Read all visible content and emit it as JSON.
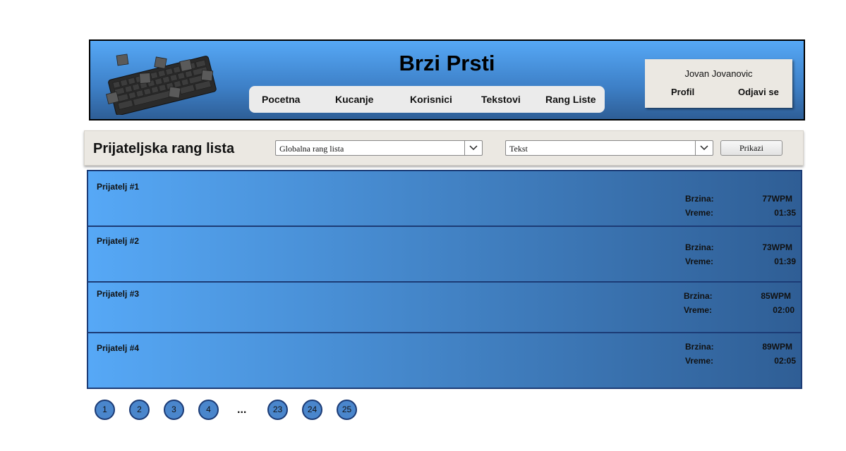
{
  "header": {
    "title": "Brzi Prsti",
    "nav": [
      {
        "label": "Pocetna"
      },
      {
        "label": "Kucanje"
      },
      {
        "label": "Korisnici"
      },
      {
        "label": "Tekstovi"
      },
      {
        "label": "Rang Liste"
      }
    ],
    "user": {
      "name": "Jovan Jovanovic",
      "profile_label": "Profil",
      "logout_label": "Odjavi se"
    }
  },
  "filter": {
    "title": "Prijateljska rang lista",
    "ranking_select": "Globalna rang lista",
    "text_select": "Tekst",
    "show_button": "Prikazi"
  },
  "entries": [
    {
      "name": "Prijatelj #1",
      "speed_label": "Brzina:",
      "speed": "77WPM",
      "time_label": "Vreme:",
      "time": "01:35"
    },
    {
      "name": "Prijatelj #2",
      "speed_label": "Brzina:",
      "speed": "73WPM",
      "time_label": "Vreme:",
      "time": "01:39"
    },
    {
      "name": "Prijatelj #3",
      "speed_label": "Brzina:",
      "speed": "85WPM",
      "time_label": "Vreme:",
      "time": "02:00"
    },
    {
      "name": "Prijatelj #4",
      "speed_label": "Brzina:",
      "speed": "89WPM",
      "time_label": "Vreme:",
      "time": "02:05"
    }
  ],
  "pagination": {
    "pages": [
      "1",
      "2",
      "3",
      "4",
      "23",
      "24",
      "25"
    ],
    "ellipsis": "..."
  },
  "colors": {
    "header_gradient_top": "#56a8f6",
    "header_gradient_bottom": "#2e5e96",
    "row_border": "#1c3b75",
    "panel_bg": "#ebe8e2"
  }
}
